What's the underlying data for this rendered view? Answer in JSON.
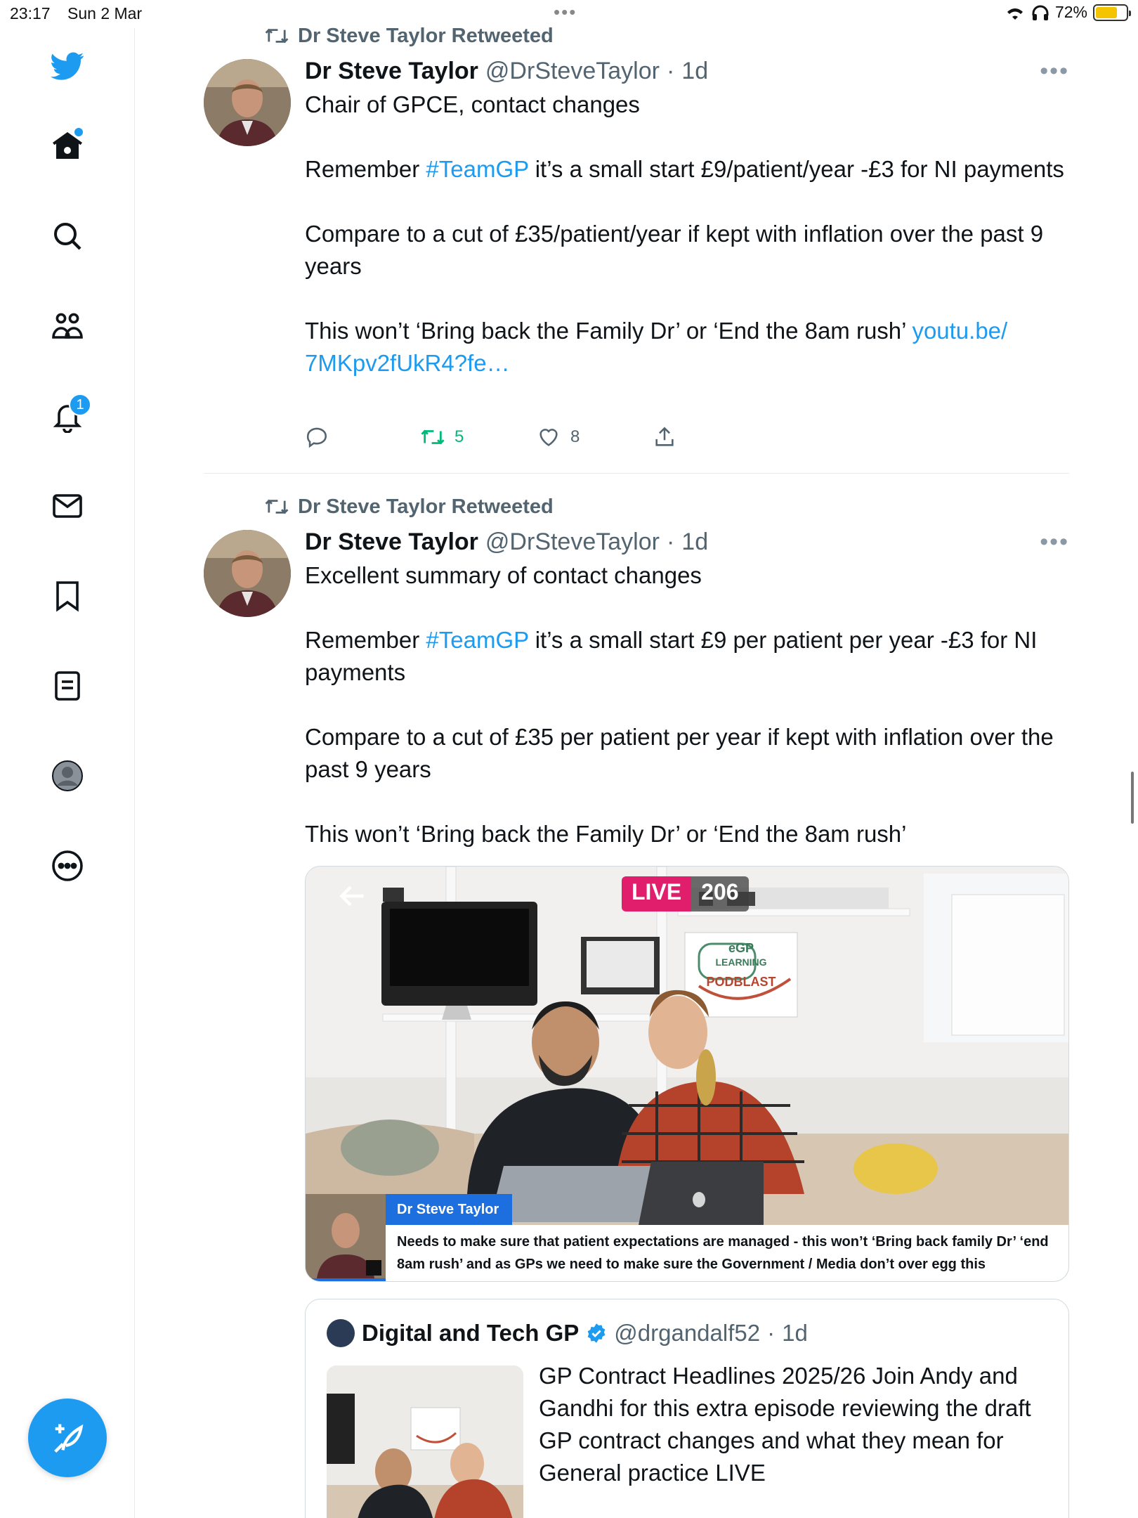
{
  "status_bar": {
    "time": "23:17",
    "date": "Sun 2 Mar",
    "battery": "72%",
    "battery_level": 0.72,
    "battery_color": "#f5c400"
  },
  "sidebar": {
    "items": [
      {
        "name": "twitter-logo-icon"
      },
      {
        "name": "home-icon",
        "has_dot": true
      },
      {
        "name": "search-icon"
      },
      {
        "name": "communities-icon"
      },
      {
        "name": "notifications-icon",
        "badge": "1"
      },
      {
        "name": "messages-icon"
      },
      {
        "name": "bookmarks-icon"
      },
      {
        "name": "lists-icon"
      },
      {
        "name": "profile-icon"
      },
      {
        "name": "more-icon"
      }
    ],
    "compose_icon": "compose-icon"
  },
  "colors": {
    "brand": "#1d9bf0",
    "retweet_active": "#00ba7c",
    "secondary_text": "#536471",
    "live": "#e01e6b"
  },
  "tweets": [
    {
      "retweet_label": "Dr Steve Taylor Retweeted",
      "name": "Dr Steve Taylor",
      "handle": "@DrSteveTaylor",
      "sep": "·",
      "time": "1d",
      "p1": "Chair of GPCE, contact changes",
      "p2_pre": "Remember ",
      "p2_tag": "#TeamGP",
      "p2_post": " it’s a small start £9/patient/year -£3 for NI payments",
      "p3": "Compare to a cut of £35/patient/year if kept with inflation over the past 9 years",
      "p4_pre": "This won’t ‘Bring back the Family Dr’ or ‘End the 8am rush’ ",
      "p4_link": "youtu.be/ 7MKpv2fUkR4?fe…",
      "retweets": "5",
      "likes": "8"
    },
    {
      "retweet_label": "Dr Steve Taylor Retweeted",
      "name": "Dr Steve Taylor",
      "handle": "@DrSteveTaylor",
      "sep": "·",
      "time": "1d",
      "p1": "Excellent summary of contact changes",
      "p2_pre": "Remember ",
      "p2_tag": "#TeamGP",
      "p2_post": " it’s a small start £9 per patient per year -£3 for NI payments",
      "p3": "Compare to a cut of £35 per patient per year if kept with inflation over the past 9 years",
      "p4": "This won’t ‘Bring back the Family Dr’ or ‘End the 8am rush’",
      "media": {
        "live_label": "LIVE",
        "viewers": "206",
        "logo_text_1": "eGP",
        "logo_text_2": "LEARNING",
        "logo_text_3": "PODBLAST",
        "lower_third_name": "Dr Steve Taylor",
        "lower_third_text": "Needs to make sure that patient expectations are managed - this won’t ‘Bring back family Dr’ ‘end 8am rush’ and as GPs we need to make sure the Government / Media don’t over egg this"
      },
      "quote": {
        "name": "Digital and Tech GP",
        "handle": "@drgandalf52",
        "sep": "·",
        "time": "1d",
        "text": "GP Contract Headlines 2025/26 Join Andy and Gandhi for this extra episode reviewing the draft GP contract changes and what they mean for General practice LIVE"
      }
    }
  ]
}
